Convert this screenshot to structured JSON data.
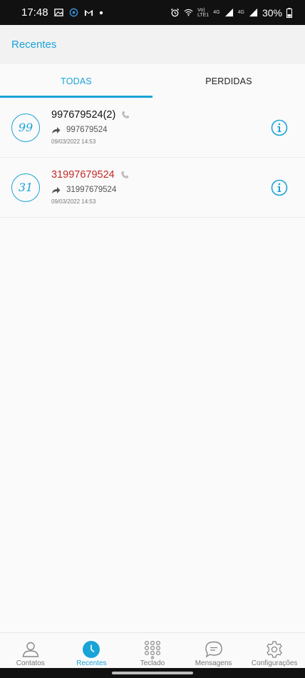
{
  "status_bar": {
    "time": "17:48",
    "net_top": "Vo)",
    "net_bottom": "LTE1",
    "sig1": "4G",
    "sig2": "4G",
    "battery": "30%"
  },
  "app_bar": {
    "title": "Recentes"
  },
  "tabs": [
    {
      "label": "TODAS",
      "active": true
    },
    {
      "label": "PERDIDAS",
      "active": false
    }
  ],
  "calls": [
    {
      "avatar": "99",
      "name": "997679524(2)",
      "number": "997679524",
      "date": "09/03/2022 14:53",
      "missed": false,
      "direction_icon": "outgoing-arrow-icon"
    },
    {
      "avatar": "31",
      "name": "31997679524",
      "number": "31997679524",
      "date": "09/03/2022 14:53",
      "missed": true,
      "direction_icon": "outgoing-arrow-icon"
    }
  ],
  "bottom_nav": [
    {
      "label": "Contatos",
      "icon": "person-icon",
      "active": false
    },
    {
      "label": "Recentes",
      "icon": "clock-icon",
      "active": true
    },
    {
      "label": "Teclado",
      "icon": "dialpad-icon",
      "active": false
    },
    {
      "label": "Mensagens",
      "icon": "message-icon",
      "active": false
    },
    {
      "label": "Configurações",
      "icon": "gear-icon",
      "active": false
    }
  ],
  "colors": {
    "accent": "#1aa3d8",
    "missed": "#c62828"
  }
}
